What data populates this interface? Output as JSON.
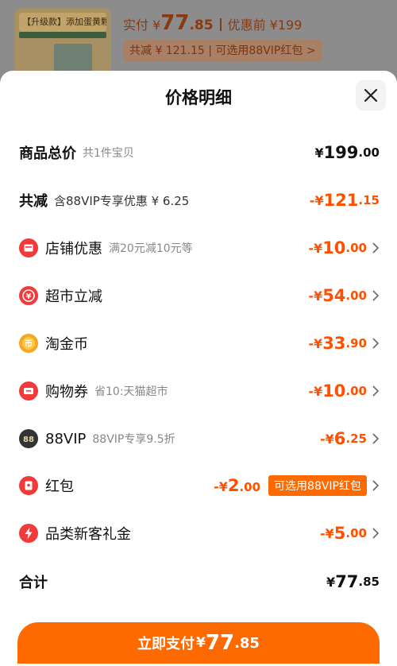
{
  "banner": {
    "product_tag": "【升级款】添加蛋黄颗粒",
    "price_prefix": "实付 ¥",
    "price_int": "77",
    "price_dec": ".85",
    "original_label": "优惠前 ¥199",
    "saved_pill": "共减 ¥ 121.15 | 可选用88VIP红包 >"
  },
  "sheet": {
    "title": "价格明细"
  },
  "rows": {
    "total": {
      "label": "商品总价",
      "sub": "共1件宝贝",
      "cur": "¥",
      "int": "199",
      "dec": ".00"
    },
    "reduce": {
      "label": "共减",
      "sub": "含88VIP专享优惠 ¥ 6.25",
      "cur": "-¥",
      "int": "121",
      "dec": ".15"
    },
    "shop": {
      "label": "店铺优惠",
      "sub": "满20元减10元等",
      "cur": "-¥",
      "int": "10",
      "dec": ".00"
    },
    "market": {
      "label": "超市立减",
      "sub": "",
      "cur": "-¥",
      "int": "54",
      "dec": ".00"
    },
    "coin": {
      "label": "淘金币",
      "sub": "",
      "cur": "-¥",
      "int": "33",
      "dec": ".90"
    },
    "coupon": {
      "label": "购物券",
      "sub": "省10:天猫超市",
      "cur": "-¥",
      "int": "10",
      "dec": ".00"
    },
    "vip": {
      "label": "88VIP",
      "sub": "88VIP专享9.5折",
      "cur": "-¥",
      "int": "6",
      "dec": ".25"
    },
    "redpacket": {
      "label": "红包",
      "sub": "",
      "cur": "-¥",
      "int": "2",
      "dec": ".00",
      "pill": "可选用88VIP红包"
    },
    "newcustomer": {
      "label": "品类新客礼金",
      "sub": "",
      "cur": "-¥",
      "int": "5",
      "dec": ".00"
    },
    "sum": {
      "label": "合计",
      "cur": "¥",
      "int": "77",
      "dec": ".85"
    }
  },
  "pay": {
    "label": "立即支付",
    "cur": "¥",
    "int": "77",
    "dec": ".85"
  },
  "colors": {
    "accent": "#ff6a00",
    "amount_orange": "#ff5000",
    "icon_red": "#f23a3a",
    "icon_gold": "#f5a623",
    "icon_dark": "#333333"
  },
  "icons": [
    "close-icon",
    "shop-icon",
    "yen-icon",
    "coin-icon",
    "ticket-icon",
    "vip-icon",
    "redpacket-icon",
    "lightning-icon",
    "chevron-right-icon"
  ]
}
